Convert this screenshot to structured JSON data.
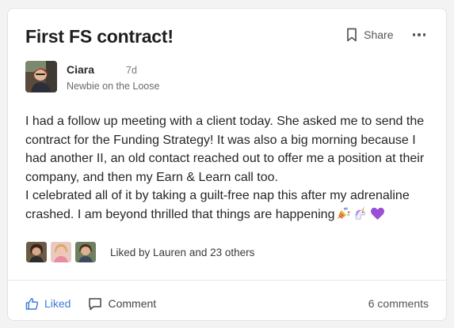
{
  "post": {
    "title": "First FS contract!",
    "share_label": "Share",
    "author": {
      "name": "Ciara",
      "age": "7d",
      "title": "Newbie on the Loose"
    },
    "body_line1": "I had a follow up meeting with a client today. She asked me to send the contract for the Funding Strategy! It was also a big morning because I had another II, an old contact reached out to offer me a position at their company, and then my Earn & Learn call too.",
    "body_line2": "I celebrated all of it by taking a guilt-free nap this after my adrenaline crashed. I am beyond thrilled that things are happening",
    "emojis": [
      "party-popper-icon",
      "unicorn-icon",
      "purple-heart-icon"
    ],
    "likes_text": "Liked by Lauren and 23 others"
  },
  "footer": {
    "like_label": "Liked",
    "comment_label": "Comment",
    "comment_count": "6 comments"
  },
  "colors": {
    "accent": "#3b7dd8",
    "card_bg": "#ffffff",
    "page_bg": "#f3f3f3"
  }
}
